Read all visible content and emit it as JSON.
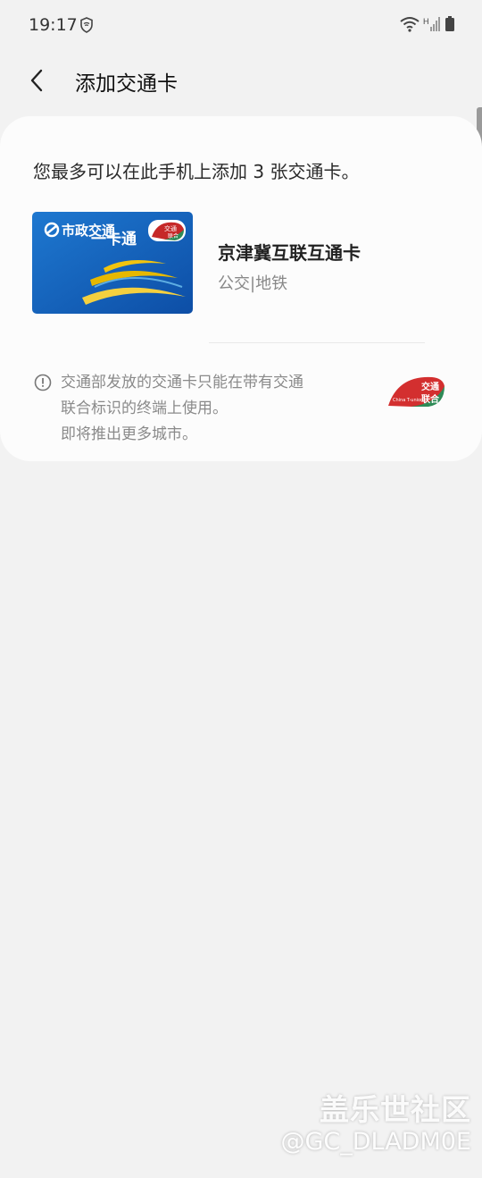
{
  "status_bar": {
    "time": "19:17",
    "icons": [
      "vpn-shield-icon",
      "wifi-icon",
      "cellular-signal-icon",
      "battery-icon"
    ],
    "network_label": "H"
  },
  "header": {
    "title": "添加交通卡",
    "back_icon": "chevron-left-icon"
  },
  "content": {
    "limit_text": "您最多可以在此手机上添加 3 张交通卡。",
    "cards": [
      {
        "name": "京津冀互联互通卡",
        "type": "公交|地铁",
        "image_text": {
          "brand": "市政交通",
          "product": "一卡通",
          "badge_top": "交通",
          "badge_bottom": "联合"
        }
      }
    ],
    "notice_lines": [
      "交通部发放的交通卡只能在带有交通",
      "联合标识的终端上使用。",
      "即将推出更多城市。"
    ],
    "notice_icon": "info-icon",
    "logo": {
      "top": "交通",
      "bottom": "联合",
      "en": "China T-union"
    }
  },
  "watermark": {
    "title": "盖乐世社区",
    "user": "@GC_DLADM0E"
  },
  "colors": {
    "background": "#f2f2f2",
    "panel": "#fcfcfc",
    "card_blue": "#1565c0",
    "tunion_red": "#d32f2f",
    "tunion_green": "#2e8b57"
  }
}
